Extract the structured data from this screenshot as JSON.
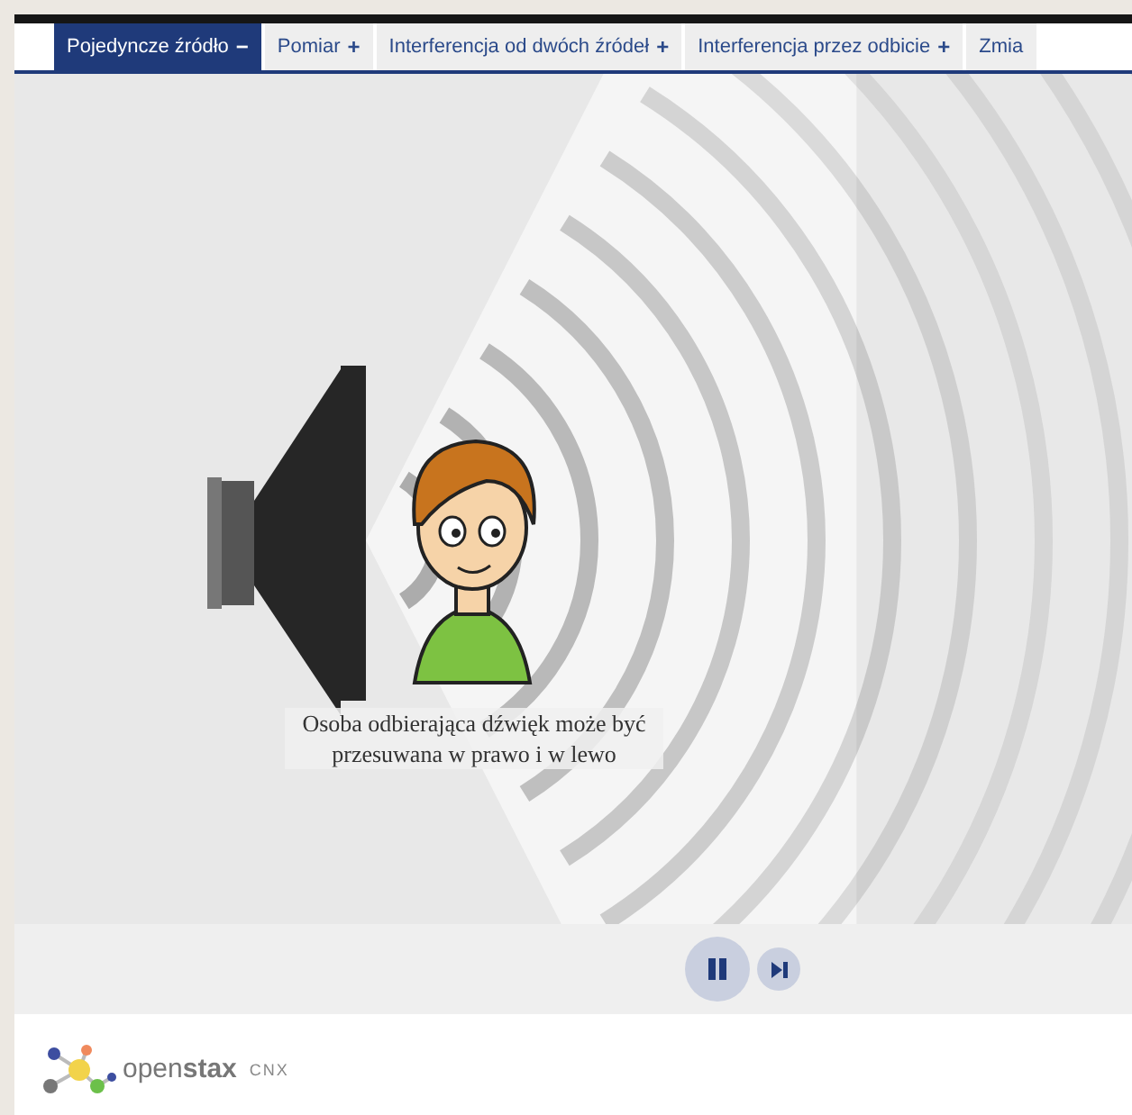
{
  "tabs": [
    {
      "label": "Pojedyncze źródło",
      "sign": "−",
      "selected": true
    },
    {
      "label": "Pomiar",
      "sign": "+",
      "selected": false
    },
    {
      "label": "Interferencja od dwóch źródeł",
      "sign": "+",
      "selected": false
    },
    {
      "label": "Interferencja przez odbicie",
      "sign": "+",
      "selected": false
    },
    {
      "label": "Zmia",
      "selected": false
    }
  ],
  "simulation": {
    "caption": "Osoba odbierająca dźwięk może być przesuwana w prawo i w lewo"
  },
  "controls": {
    "playing": true
  },
  "footer": {
    "logo": "open**stax**",
    "suffix": "CNX"
  }
}
